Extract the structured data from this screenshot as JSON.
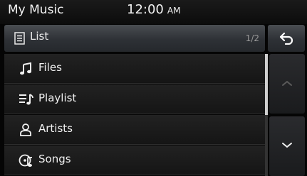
{
  "status_bar": {
    "app_title": "My Music",
    "time": "12:00",
    "ampm": "AM"
  },
  "header": {
    "label": "List",
    "page_indicator": "1/2",
    "icon": "list-icon"
  },
  "back_button": {
    "icon": "back-arrow-icon"
  },
  "list": {
    "items": [
      {
        "label": "Files",
        "icon": "music-note-icon"
      },
      {
        "label": "Playlist",
        "icon": "playlist-icon"
      },
      {
        "label": "Artists",
        "icon": "artist-icon"
      },
      {
        "label": "Songs",
        "icon": "songs-icon"
      }
    ]
  },
  "scroll": {
    "position_fraction": 0.0,
    "visible_fraction": 0.5,
    "up_icon": "chevron-up-icon",
    "down_icon": "chevron-down-icon"
  },
  "colors": {
    "background": "#050505",
    "header_gradient_top": "#4a4d52",
    "text": "#f0f0f0",
    "dim_text": "#9a9a9a",
    "scroll_thumb": "#cfcfcf"
  }
}
